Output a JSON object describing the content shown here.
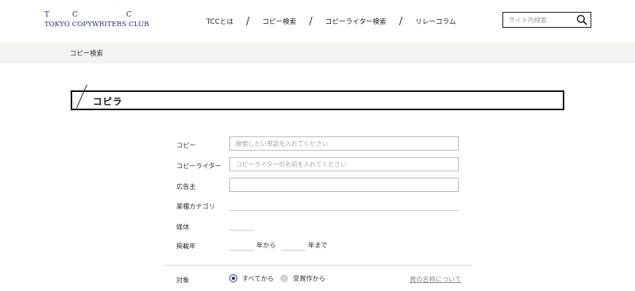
{
  "header": {
    "logo": {
      "letters": [
        "T",
        "C",
        "C"
      ],
      "subtitle": "TOKYO COPYWRITERS CLUB"
    },
    "nav": [
      {
        "label": "TCCとは"
      },
      {
        "label": "コピー検索"
      },
      {
        "label": "コピーライター検索"
      },
      {
        "label": "リレーコラム"
      }
    ],
    "search": {
      "placeholder": "サイト内検索",
      "icon": "search-icon"
    }
  },
  "breadcrumb": {
    "current": "コピー検索"
  },
  "section": {
    "title": "コピラ"
  },
  "form": {
    "fields": {
      "copy": {
        "label": "コピー",
        "value": "",
        "placeholder": "検索したい単語を入れてください"
      },
      "copywriter": {
        "label": "コピーライター",
        "value": "",
        "placeholder": "コピーライターの名前を入れてください"
      },
      "advertiser": {
        "label": "広告主",
        "value": "",
        "placeholder": ""
      },
      "industry": {
        "label": "業種カテゴリ",
        "value": ""
      },
      "media": {
        "label": "媒体",
        "value": ""
      },
      "year": {
        "label": "掲載年",
        "from_value": "",
        "from_unit": "年から",
        "to_value": "",
        "to_unit": "年まで"
      }
    },
    "target": {
      "label": "対象",
      "options": [
        {
          "label": "すべてから",
          "selected": true
        },
        {
          "label": "受賞作から",
          "selected": false
        }
      ],
      "help_link": "賞の名称について"
    }
  },
  "colors": {
    "brand": "#1f2d7a",
    "band": "#f4f3ef"
  }
}
